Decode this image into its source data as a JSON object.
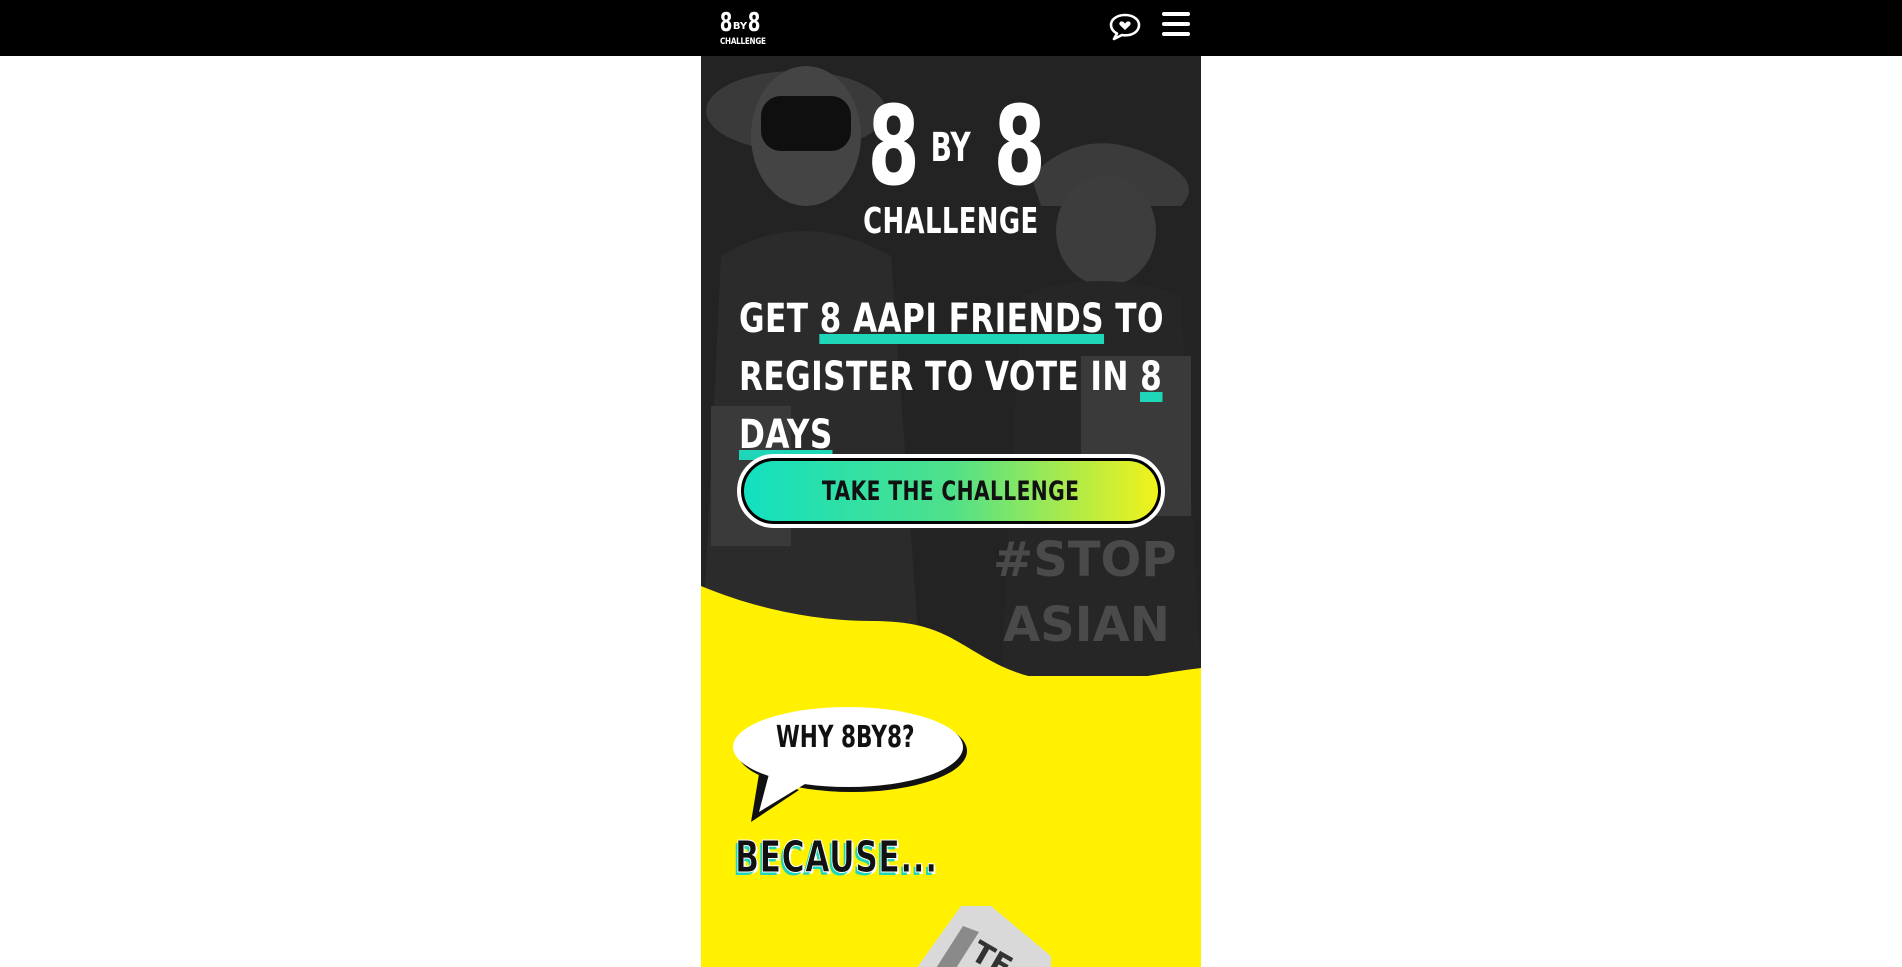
{
  "header": {
    "logo": {
      "left_num": "8",
      "by": "BY",
      "right_num": "8",
      "sub": "CHALLENGE"
    },
    "chat_icon": "chat-heart-icon",
    "menu_icon": "hamburger-menu-icon"
  },
  "hero": {
    "logo": {
      "left_num": "8",
      "by": "BY",
      "right_num": "8",
      "sub": "CHALLENGE"
    },
    "headline": {
      "p1": "GET ",
      "h1": "8 AAPI FRIENDS",
      "p2": " TO",
      "p3": "REGISTER TO VOTE IN ",
      "h2": "8 DAYS"
    },
    "cta_label": "TAKE THE CHALLENGE",
    "background_text": "#STOP ASIAN"
  },
  "why": {
    "bubble_text": "WHY 8BY8?",
    "because_text": "BECAUSE..."
  },
  "colors": {
    "accent_teal": "#1fd6b8",
    "accent_yellow": "#fff100",
    "dark": "#1b1b1b"
  }
}
